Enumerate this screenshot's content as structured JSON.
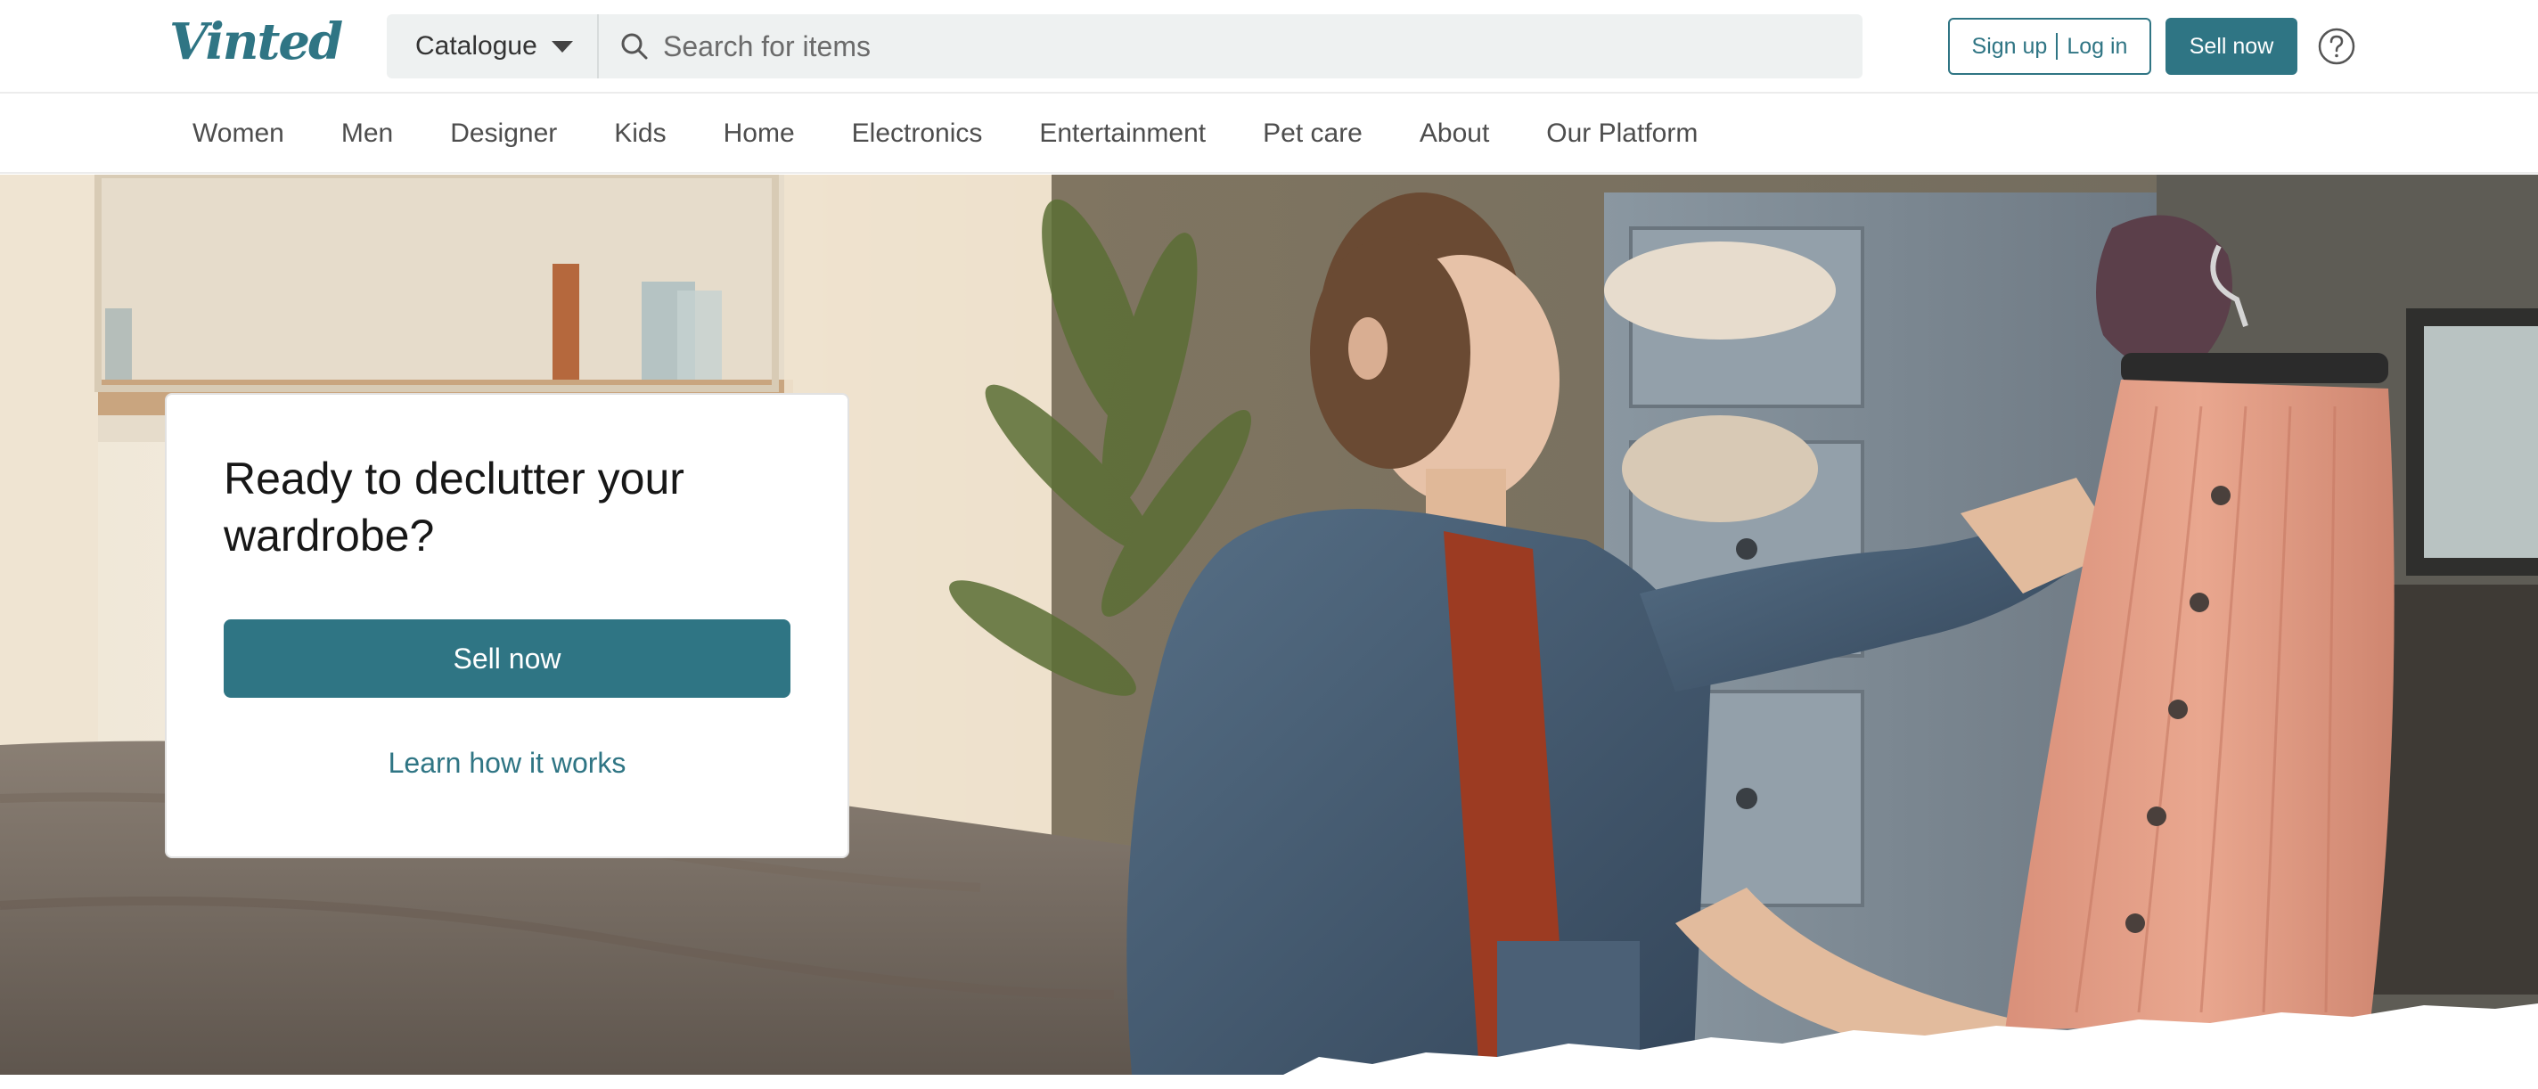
{
  "header": {
    "logo_text": "Vinted",
    "catalogue_label": "Catalogue",
    "search_placeholder": "Search for items",
    "signup_label": "Sign up",
    "login_label": "Log in",
    "sell_now_label": "Sell now",
    "help_icon": "question-circle-icon"
  },
  "nav": {
    "items": [
      {
        "label": "Women"
      },
      {
        "label": "Men"
      },
      {
        "label": "Designer"
      },
      {
        "label": "Kids"
      },
      {
        "label": "Home"
      },
      {
        "label": "Electronics"
      },
      {
        "label": "Entertainment"
      },
      {
        "label": "Pet care"
      },
      {
        "label": "About"
      },
      {
        "label": "Our Platform"
      }
    ]
  },
  "hero": {
    "title": "Ready to declutter your wardrobe?",
    "sell_now_label": "Sell now",
    "learn_link_label": "Learn how it works"
  },
  "colors": {
    "brand": "#2f7584",
    "search_bg": "#eef1f1"
  }
}
